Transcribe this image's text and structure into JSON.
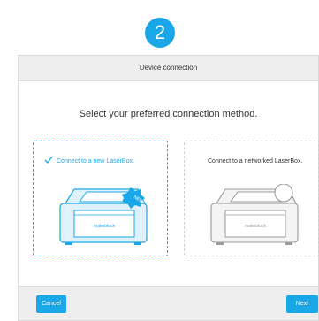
{
  "step": {
    "number": "2"
  },
  "dialog": {
    "title": "Device connection",
    "prompt": "Select your preferred connection method.",
    "options": [
      {
        "label": "Connect to a new LaserBox.",
        "selected": true,
        "badge": "NEW",
        "device_brand": "makeblock"
      },
      {
        "label": "Connect to a networked LaserBox.",
        "selected": false,
        "device_brand": "makeblock"
      }
    ],
    "footer": {
      "cancel_label": "Cancel",
      "next_label": "Next"
    }
  },
  "colors": {
    "accent": "#1aa7e8",
    "header_bg": "#eeeeee",
    "inactive": "#cfcfcf"
  }
}
